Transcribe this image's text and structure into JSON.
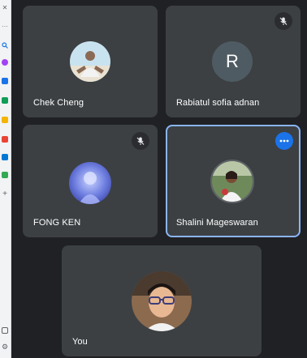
{
  "sidebar": {
    "icons": [
      "close-icon",
      "more-icon",
      "search-icon",
      "sparkle-icon",
      "bookmark-icon",
      "bag-icon",
      "folder-icon",
      "office-icon",
      "outlook-icon",
      "drive-icon",
      "add-icon",
      "window-icon",
      "settings-icon"
    ]
  },
  "participants": [
    {
      "name": "Chek Cheng",
      "avatar_type": "photo",
      "muted": false
    },
    {
      "name": "Rabiatul sofia adnan",
      "avatar_type": "letter",
      "avatar_letter": "R",
      "muted": true
    },
    {
      "name": "FONG KEN",
      "avatar_type": "photo",
      "muted": true
    },
    {
      "name": "Shalini Mageswaran",
      "avatar_type": "photo",
      "muted": false,
      "active": true
    },
    {
      "name": "You",
      "avatar_type": "photo",
      "muted": false
    }
  ],
  "colors": {
    "background": "#202124",
    "tile": "#3c4043",
    "active_border": "#8ab4f8",
    "more_button": "#1a73e8"
  }
}
